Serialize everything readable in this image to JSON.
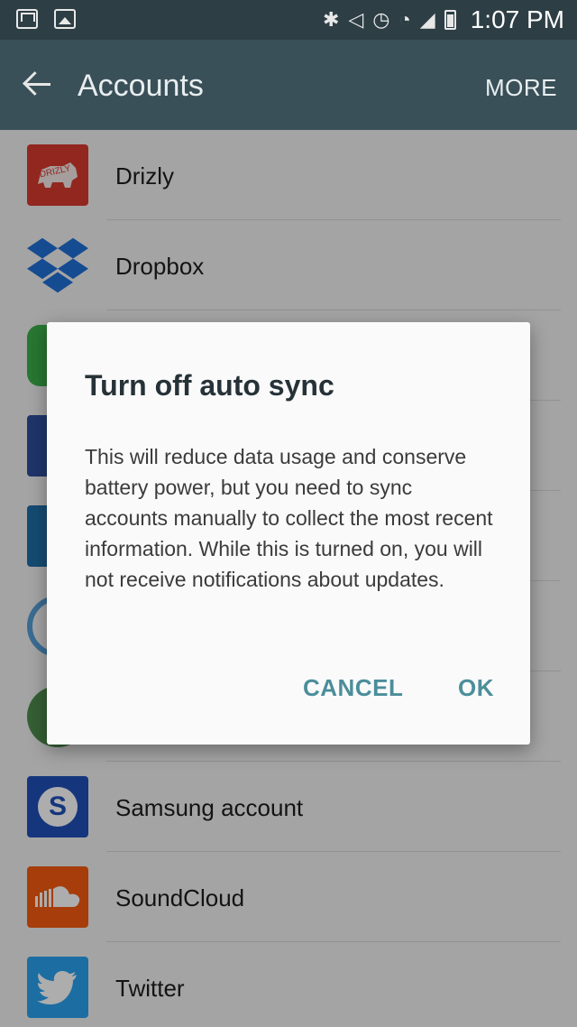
{
  "status_bar": {
    "time": "1:07 PM",
    "left_icons": [
      "gmail-icon",
      "gallery-icon"
    ],
    "right_icons": [
      "bluetooth-icon",
      "mute-icon",
      "alarm-icon",
      "wifi-icon",
      "signal-icon",
      "battery-icon"
    ]
  },
  "app_bar": {
    "title": "Accounts",
    "more_label": "MORE"
  },
  "accounts": [
    {
      "label": "Drizly",
      "icon": "drizly-icon",
      "color": "#d63a2f"
    },
    {
      "label": "Dropbox",
      "icon": "dropbox-icon",
      "color": "#1f6fd6"
    },
    {
      "label": "",
      "icon": "app-icon-green",
      "color": "#3bb04a"
    },
    {
      "label": "",
      "icon": "app-icon-navy",
      "color": "#2f4f9c"
    },
    {
      "label": "",
      "icon": "app-icon-blue",
      "color": "#1f6fa8"
    },
    {
      "label": "",
      "icon": "app-icon-ring",
      "color": "#56a0d8"
    },
    {
      "label": "",
      "icon": "app-icon-green2",
      "color": "#4f8c4f"
    },
    {
      "label": "Samsung account",
      "icon": "samsung-account-icon",
      "color": "#1f4fb8"
    },
    {
      "label": "SoundCloud",
      "icon": "soundcloud-icon",
      "color": "#f55a10"
    },
    {
      "label": "Twitter",
      "icon": "twitter-icon",
      "color": "#2aa3ef"
    }
  ],
  "dialog": {
    "title": "Turn off auto sync",
    "message": "This will reduce data usage and conserve battery power, but you need to sync accounts manually to collect the most recent information. While this is turned on, you will not receive notifications about updates.",
    "cancel_label": "CANCEL",
    "ok_label": "OK",
    "button_color": "#4b8e9a"
  }
}
